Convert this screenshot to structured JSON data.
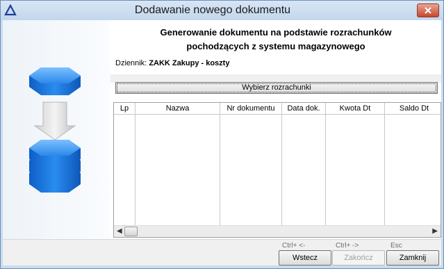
{
  "window": {
    "title": "Dodawanie nowego dokumentu"
  },
  "header": {
    "title_line1": "Generowanie dokumentu na podstawie rozrachunków",
    "title_line2": "pochodzących z systemu magazynowego",
    "journal_label": "Dziennik:",
    "journal_value": "ZAKK Zakupy - koszty"
  },
  "choose_button": "Wybierz rozrachunki",
  "grid": {
    "columns": [
      "Lp",
      "Nazwa",
      "Nr dokumentu",
      "Data dok.",
      "Kwota Dt",
      "Saldo Dt"
    ],
    "rows": []
  },
  "footer": {
    "back": {
      "shortcut": "Ctrl+ <-",
      "label": "Wstecz"
    },
    "finish": {
      "shortcut": "Ctrl+ ->",
      "label": "Zakończ",
      "disabled": true
    },
    "close": {
      "shortcut": "Esc",
      "label": "Zamknij"
    }
  },
  "colors": {
    "accent_blue": "#1f7ee0",
    "title_bar": "#c9dcef",
    "close_red": "#c7462c"
  }
}
